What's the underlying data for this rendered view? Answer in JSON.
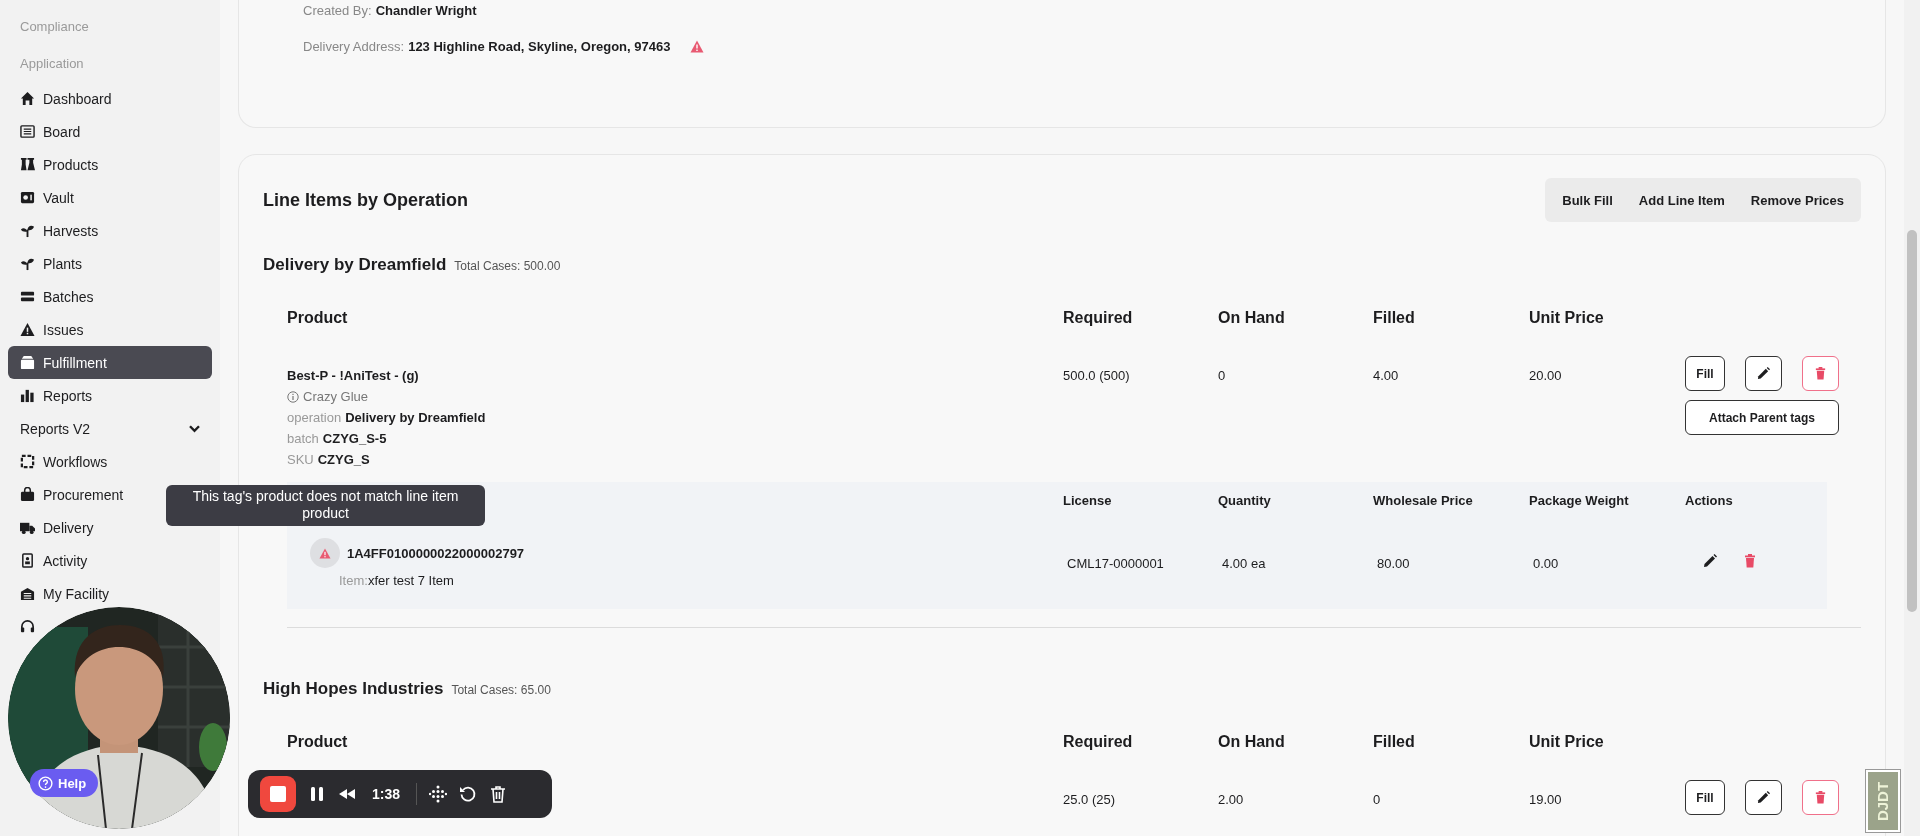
{
  "sidebar": {
    "items": [
      {
        "kind": "heading",
        "label": "Compliance"
      },
      {
        "kind": "heading",
        "label": "Application"
      },
      {
        "kind": "link",
        "label": "Dashboard",
        "selected": false
      },
      {
        "kind": "link",
        "label": "Board",
        "selected": false
      },
      {
        "kind": "link",
        "label": "Products",
        "selected": false
      },
      {
        "kind": "link",
        "label": "Vault",
        "selected": false
      },
      {
        "kind": "link",
        "label": "Harvests",
        "selected": false
      },
      {
        "kind": "link",
        "label": "Plants",
        "selected": false
      },
      {
        "kind": "link",
        "label": "Batches",
        "selected": false
      },
      {
        "kind": "link",
        "label": "Issues",
        "selected": false
      },
      {
        "kind": "link",
        "label": "Fulfillment",
        "selected": true
      },
      {
        "kind": "link",
        "label": "Reports",
        "selected": false
      },
      {
        "kind": "group",
        "label": "Reports V2",
        "expanded": false
      },
      {
        "kind": "link",
        "label": "Workflows",
        "selected": false
      },
      {
        "kind": "link",
        "label": "Procurement",
        "selected": false
      },
      {
        "kind": "link",
        "label": "Delivery",
        "selected": false
      },
      {
        "kind": "link",
        "label": "Activity",
        "selected": false
      },
      {
        "kind": "link",
        "label": "My Facility",
        "selected": false
      },
      {
        "kind": "icon_only",
        "selected": false
      }
    ]
  },
  "order_details": {
    "fields": [
      {
        "label": "Created By:",
        "value": "Chandler Wright",
        "warning": false
      },
      {
        "label": "Delivery Address:",
        "value": "123 Highline Road, Skyline, Oregon, 97463",
        "warning": true
      }
    ]
  },
  "line_items": {
    "title": "Line Items by Operation",
    "actions": [
      "Bulk Fill",
      "Add Line Item",
      "Remove Prices"
    ],
    "operations": [
      {
        "name": "Delivery by Dreamfield",
        "total_cases": "Total Cases: 500.00",
        "columns": [
          "Product",
          "Required",
          "On Hand",
          "Filled",
          "Unit Price"
        ],
        "rows": [
          {
            "product": "Best-P - !AniTest - (g)",
            "strain": "Crazy Glue",
            "details": [
              {
                "label": "operation",
                "value": "Delivery by Dreamfield"
              },
              {
                "label": "batch",
                "value": "CZYG_S-5"
              },
              {
                "label": "SKU",
                "value": "CZYG_S"
              }
            ],
            "required": "500.0 (500)",
            "on_hand": "0",
            "filled": "4.00",
            "unit_price": "20.00",
            "fill_button": "Fill",
            "attach_button": "Attach Parent tags",
            "tags": {
              "columns": [
                "License",
                "Quantity",
                "Wholesale Price",
                "Package Weight",
                "Actions"
              ],
              "rows": [
                {
                  "tag": "1A4FF0100000022000002797",
                  "warning": true,
                  "tooltip": "This tag's product does not match line item product",
                  "item_label": "Item:",
                  "item": "xfer test 7 Item",
                  "license": "CML17-0000001",
                  "quantity": "4.00 ea",
                  "wholesale_price": "80.00",
                  "package_weight": "0.00"
                }
              ]
            }
          }
        ]
      },
      {
        "name": "High Hopes Industries",
        "total_cases": "Total Cases: 65.00",
        "columns": [
          "Product",
          "Required",
          "On Hand",
          "Filled",
          "Unit Price"
        ],
        "rows": [
          {
            "required": "25.0 (25)",
            "on_hand": "2.00",
            "filled": "0",
            "unit_price": "19.00",
            "fill_button": "Fill"
          }
        ]
      }
    ]
  },
  "help_button": {
    "label": "Help"
  },
  "recorder": {
    "time": "1:38",
    "recording": true
  },
  "debug_toolbar": {
    "label": "DJDT"
  }
}
